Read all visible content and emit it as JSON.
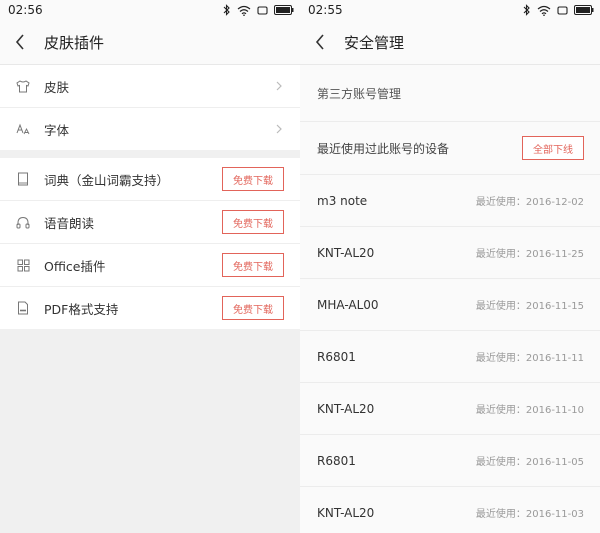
{
  "left": {
    "status_time": "02:56",
    "title": "皮肤插件",
    "group1": [
      {
        "label": "皮肤",
        "icon": "shirt-icon"
      },
      {
        "label": "字体",
        "icon": "font-icon"
      }
    ],
    "group2": [
      {
        "label": "词典（金山词霸支持）",
        "icon": "book-icon",
        "button": "免费下载"
      },
      {
        "label": "语音朗读",
        "icon": "headphones-icon",
        "button": "免费下载"
      },
      {
        "label": "Office插件",
        "icon": "office-grid-icon",
        "button": "免费下载"
      },
      {
        "label": "PDF格式支持",
        "icon": "pdf-file-icon",
        "button": "免费下载"
      }
    ]
  },
  "right": {
    "status_time": "02:55",
    "title": "安全管理",
    "section_title": "第三方账号管理",
    "devices_title": "最近使用过此账号的设备",
    "logout_all": "全部下线",
    "devices": [
      {
        "name": "m3 note",
        "time": "最近使用：2016-12-02"
      },
      {
        "name": "KNT-AL20",
        "time": "最近使用：2016-11-25"
      },
      {
        "name": "MHA-AL00",
        "time": "最近使用：2016-11-15"
      },
      {
        "name": "R6801",
        "time": "最近使用：2016-11-11"
      },
      {
        "name": "KNT-AL20",
        "time": "最近使用：2016-11-10"
      },
      {
        "name": "R6801",
        "time": "最近使用：2016-11-05"
      },
      {
        "name": "KNT-AL20",
        "time": "最近使用：2016-11-03"
      }
    ]
  },
  "colors": {
    "accent_red": "#e2645a",
    "bg": "#f0f0f0"
  }
}
